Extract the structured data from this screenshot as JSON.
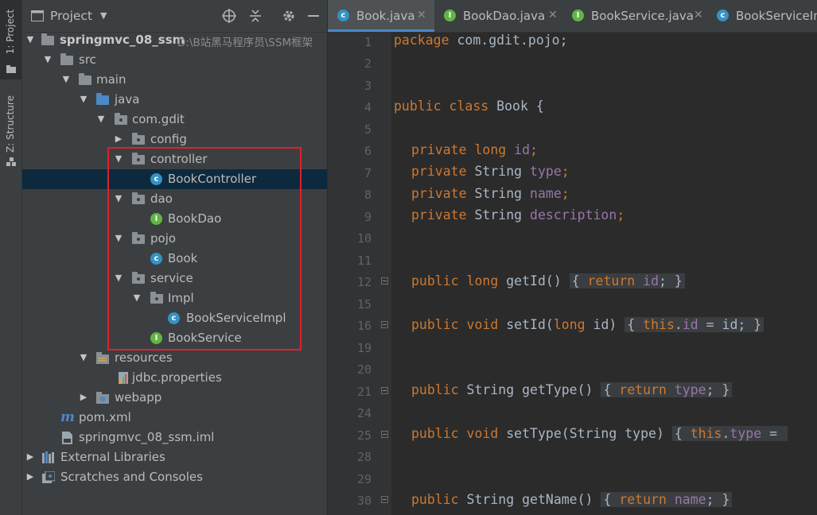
{
  "toolstrip": {
    "project_tab": "1: Project",
    "structure_tab": "Z: Structure"
  },
  "project_panel": {
    "title": "Project",
    "tree": [
      {
        "label": "springmvc_08_ssm",
        "path": "D:\\B站黑马程序员\\SSM框架",
        "icon": "module-folder-icon",
        "expanded": true
      },
      {
        "label": "src",
        "icon": "folder-icon",
        "expanded": true
      },
      {
        "label": "main",
        "icon": "folder-icon",
        "expanded": true
      },
      {
        "label": "java",
        "icon": "source-folder-icon",
        "expanded": true
      },
      {
        "label": "com.gdit",
        "icon": "package-icon",
        "expanded": true
      },
      {
        "label": "config",
        "icon": "package-icon",
        "expanded": false
      },
      {
        "label": "controller",
        "icon": "package-icon",
        "expanded": true
      },
      {
        "label": "BookController",
        "icon": "class-icon",
        "selected": true
      },
      {
        "label": "dao",
        "icon": "package-icon",
        "expanded": true
      },
      {
        "label": "BookDao",
        "icon": "interface-icon"
      },
      {
        "label": "pojo",
        "icon": "package-icon",
        "expanded": true
      },
      {
        "label": "Book",
        "icon": "class-icon"
      },
      {
        "label": "service",
        "icon": "package-icon",
        "expanded": true
      },
      {
        "label": "Impl",
        "icon": "package-icon",
        "expanded": true
      },
      {
        "label": "BookServiceImpl",
        "icon": "class-icon"
      },
      {
        "label": "BookService",
        "icon": "interface-icon"
      },
      {
        "label": "resources",
        "icon": "resources-folder-icon",
        "expanded": true
      },
      {
        "label": "jdbc.properties",
        "icon": "properties-file-icon"
      },
      {
        "label": "webapp",
        "icon": "web-folder-icon",
        "expanded": false
      },
      {
        "label": "pom.xml",
        "icon": "maven-icon"
      },
      {
        "label": "springmvc_08_ssm.iml",
        "icon": "iml-file-icon"
      },
      {
        "label": "External Libraries",
        "icon": "libraries-icon",
        "expanded": false
      },
      {
        "label": "Scratches and Consoles",
        "icon": "scratches-icon",
        "expanded": false
      }
    ]
  },
  "editor": {
    "tabs": [
      {
        "label": "Book.java",
        "icon": "class-icon",
        "active": true,
        "closable": true
      },
      {
        "label": "BookDao.java",
        "icon": "interface-icon",
        "closable": true
      },
      {
        "label": "BookService.java",
        "icon": "interface-icon",
        "closable": true
      },
      {
        "label": "BookServiceIm",
        "icon": "class-icon"
      }
    ],
    "lines": [
      {
        "no": "1"
      },
      {
        "no": "2"
      },
      {
        "no": "3"
      },
      {
        "no": "4"
      },
      {
        "no": "5"
      },
      {
        "no": "6"
      },
      {
        "no": "7"
      },
      {
        "no": "8"
      },
      {
        "no": "9"
      },
      {
        "no": "10"
      },
      {
        "no": "11"
      },
      {
        "no": "12"
      },
      {
        "no": "15"
      },
      {
        "no": "16"
      },
      {
        "no": "19"
      },
      {
        "no": "20"
      },
      {
        "no": "21"
      },
      {
        "no": "24"
      },
      {
        "no": "25"
      },
      {
        "no": "28"
      },
      {
        "no": "29"
      },
      {
        "no": "30"
      }
    ],
    "code": {
      "l1": [
        "package",
        " com.gdit.pojo;"
      ],
      "l4": [
        "public",
        " ",
        "class",
        " Book {"
      ],
      "l6": [
        "private",
        " ",
        "long",
        " ",
        "id",
        ";"
      ],
      "l7": [
        "private",
        " String ",
        "type",
        ";"
      ],
      "l8": [
        "private",
        " String ",
        "name",
        ";"
      ],
      "l9": [
        "private",
        " String ",
        "description",
        ";"
      ],
      "l12": [
        "public",
        " ",
        "long",
        " getId()",
        "{ ",
        "return",
        " ",
        "id",
        "; }"
      ],
      "l16": [
        "public",
        " ",
        "void",
        " setId(",
        "long",
        " id)",
        "{ ",
        "this",
        ".",
        "id",
        " = id; }"
      ],
      "l21": [
        "public",
        " String getType()",
        "{ ",
        "return",
        " ",
        "type",
        "; }"
      ],
      "l25": [
        "public",
        " ",
        "void",
        " setType(String type)",
        "{ ",
        "this",
        ".",
        "type",
        " = "
      ],
      "l30": [
        "public",
        " String getName()",
        "{ ",
        "return",
        " ",
        "name",
        "; }"
      ]
    },
    "colors": {
      "keyword": "#cc7832",
      "field": "#9876aa",
      "text": "#a9b7c6",
      "line_number": "#606366"
    }
  }
}
